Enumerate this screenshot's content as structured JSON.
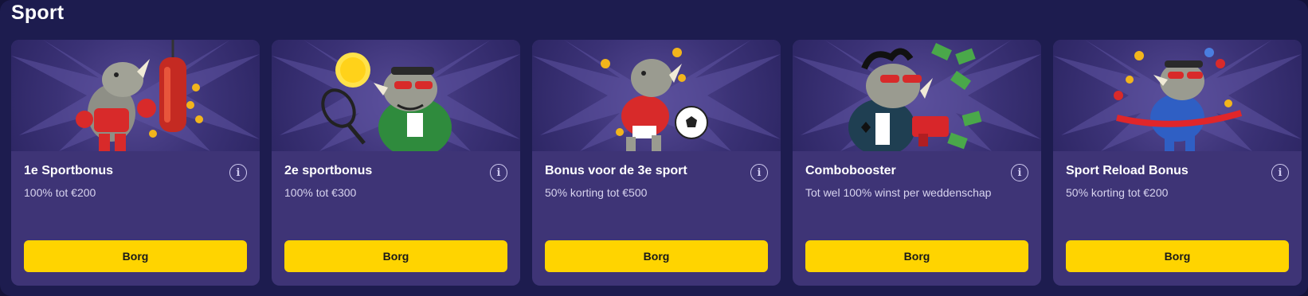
{
  "section": {
    "title": "Sport"
  },
  "cards": [
    {
      "title": "1e Sportbonus",
      "description": "100% tot €200",
      "button": "Borg",
      "illustration": "rhino-boxer"
    },
    {
      "title": "2e sportbonus",
      "description": "100% tot €300",
      "button": "Borg",
      "illustration": "rhino-tennis"
    },
    {
      "title": "Bonus voor de 3e sport",
      "description": "50% korting tot €500",
      "button": "Borg",
      "illustration": "rhino-soccer"
    },
    {
      "title": "Combobooster",
      "description": "Tot wel 100% winst per weddenschap",
      "button": "Borg",
      "illustration": "rhino-money-gun"
    },
    {
      "title": "Sport Reload Bonus",
      "description": "50% korting tot €200",
      "button": "Borg",
      "illustration": "rhino-runner"
    }
  ],
  "colors": {
    "background": "#1d1c4f",
    "card": "#3e3476",
    "button": "#ffd400",
    "button_text": "#1a1a1a"
  }
}
